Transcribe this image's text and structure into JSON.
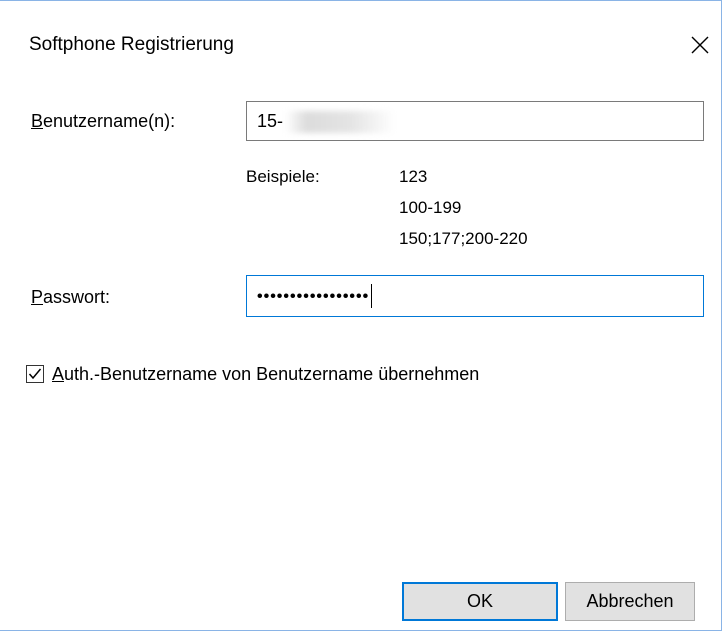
{
  "dialog": {
    "title": "Softphone Registrierung"
  },
  "username": {
    "label_accel": "B",
    "label_rest": "enutzername(n):",
    "value_prefix": "15-"
  },
  "examples": {
    "label": "Beispiele:",
    "items": [
      "123",
      "100-199",
      "150;177;200-220"
    ]
  },
  "password": {
    "label_accel": "P",
    "label_rest": "asswort:",
    "masked_value": "•••••••••••••••••"
  },
  "auth_checkbox": {
    "checked": true,
    "label_accel": "A",
    "label_rest": "uth.-Benutzername von Benutzername übernehmen"
  },
  "buttons": {
    "ok": "OK",
    "cancel": "Abbrechen"
  },
  "colors": {
    "focus_border": "#0078d7",
    "window_border": "#8ab4e6",
    "button_face": "#e1e1e1"
  }
}
